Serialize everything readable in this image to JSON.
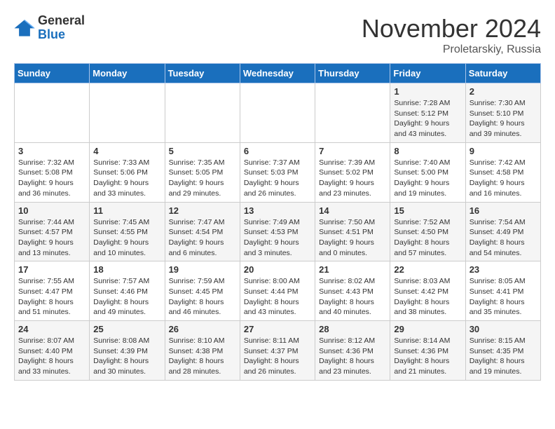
{
  "logo": {
    "general": "General",
    "blue": "Blue"
  },
  "title": "November 2024",
  "subtitle": "Proletarskiy, Russia",
  "days_header": [
    "Sunday",
    "Monday",
    "Tuesday",
    "Wednesday",
    "Thursday",
    "Friday",
    "Saturday"
  ],
  "weeks": [
    [
      {
        "day": "",
        "info": ""
      },
      {
        "day": "",
        "info": ""
      },
      {
        "day": "",
        "info": ""
      },
      {
        "day": "",
        "info": ""
      },
      {
        "day": "",
        "info": ""
      },
      {
        "day": "1",
        "info": "Sunrise: 7:28 AM\nSunset: 5:12 PM\nDaylight: 9 hours and 43 minutes."
      },
      {
        "day": "2",
        "info": "Sunrise: 7:30 AM\nSunset: 5:10 PM\nDaylight: 9 hours and 39 minutes."
      }
    ],
    [
      {
        "day": "3",
        "info": "Sunrise: 7:32 AM\nSunset: 5:08 PM\nDaylight: 9 hours and 36 minutes."
      },
      {
        "day": "4",
        "info": "Sunrise: 7:33 AM\nSunset: 5:06 PM\nDaylight: 9 hours and 33 minutes."
      },
      {
        "day": "5",
        "info": "Sunrise: 7:35 AM\nSunset: 5:05 PM\nDaylight: 9 hours and 29 minutes."
      },
      {
        "day": "6",
        "info": "Sunrise: 7:37 AM\nSunset: 5:03 PM\nDaylight: 9 hours and 26 minutes."
      },
      {
        "day": "7",
        "info": "Sunrise: 7:39 AM\nSunset: 5:02 PM\nDaylight: 9 hours and 23 minutes."
      },
      {
        "day": "8",
        "info": "Sunrise: 7:40 AM\nSunset: 5:00 PM\nDaylight: 9 hours and 19 minutes."
      },
      {
        "day": "9",
        "info": "Sunrise: 7:42 AM\nSunset: 4:58 PM\nDaylight: 9 hours and 16 minutes."
      }
    ],
    [
      {
        "day": "10",
        "info": "Sunrise: 7:44 AM\nSunset: 4:57 PM\nDaylight: 9 hours and 13 minutes."
      },
      {
        "day": "11",
        "info": "Sunrise: 7:45 AM\nSunset: 4:55 PM\nDaylight: 9 hours and 10 minutes."
      },
      {
        "day": "12",
        "info": "Sunrise: 7:47 AM\nSunset: 4:54 PM\nDaylight: 9 hours and 6 minutes."
      },
      {
        "day": "13",
        "info": "Sunrise: 7:49 AM\nSunset: 4:53 PM\nDaylight: 9 hours and 3 minutes."
      },
      {
        "day": "14",
        "info": "Sunrise: 7:50 AM\nSunset: 4:51 PM\nDaylight: 9 hours and 0 minutes."
      },
      {
        "day": "15",
        "info": "Sunrise: 7:52 AM\nSunset: 4:50 PM\nDaylight: 8 hours and 57 minutes."
      },
      {
        "day": "16",
        "info": "Sunrise: 7:54 AM\nSunset: 4:49 PM\nDaylight: 8 hours and 54 minutes."
      }
    ],
    [
      {
        "day": "17",
        "info": "Sunrise: 7:55 AM\nSunset: 4:47 PM\nDaylight: 8 hours and 51 minutes."
      },
      {
        "day": "18",
        "info": "Sunrise: 7:57 AM\nSunset: 4:46 PM\nDaylight: 8 hours and 49 minutes."
      },
      {
        "day": "19",
        "info": "Sunrise: 7:59 AM\nSunset: 4:45 PM\nDaylight: 8 hours and 46 minutes."
      },
      {
        "day": "20",
        "info": "Sunrise: 8:00 AM\nSunset: 4:44 PM\nDaylight: 8 hours and 43 minutes."
      },
      {
        "day": "21",
        "info": "Sunrise: 8:02 AM\nSunset: 4:43 PM\nDaylight: 8 hours and 40 minutes."
      },
      {
        "day": "22",
        "info": "Sunrise: 8:03 AM\nSunset: 4:42 PM\nDaylight: 8 hours and 38 minutes."
      },
      {
        "day": "23",
        "info": "Sunrise: 8:05 AM\nSunset: 4:41 PM\nDaylight: 8 hours and 35 minutes."
      }
    ],
    [
      {
        "day": "24",
        "info": "Sunrise: 8:07 AM\nSunset: 4:40 PM\nDaylight: 8 hours and 33 minutes."
      },
      {
        "day": "25",
        "info": "Sunrise: 8:08 AM\nSunset: 4:39 PM\nDaylight: 8 hours and 30 minutes."
      },
      {
        "day": "26",
        "info": "Sunrise: 8:10 AM\nSunset: 4:38 PM\nDaylight: 8 hours and 28 minutes."
      },
      {
        "day": "27",
        "info": "Sunrise: 8:11 AM\nSunset: 4:37 PM\nDaylight: 8 hours and 26 minutes."
      },
      {
        "day": "28",
        "info": "Sunrise: 8:12 AM\nSunset: 4:36 PM\nDaylight: 8 hours and 23 minutes."
      },
      {
        "day": "29",
        "info": "Sunrise: 8:14 AM\nSunset: 4:36 PM\nDaylight: 8 hours and 21 minutes."
      },
      {
        "day": "30",
        "info": "Sunrise: 8:15 AM\nSunset: 4:35 PM\nDaylight: 8 hours and 19 minutes."
      }
    ]
  ]
}
